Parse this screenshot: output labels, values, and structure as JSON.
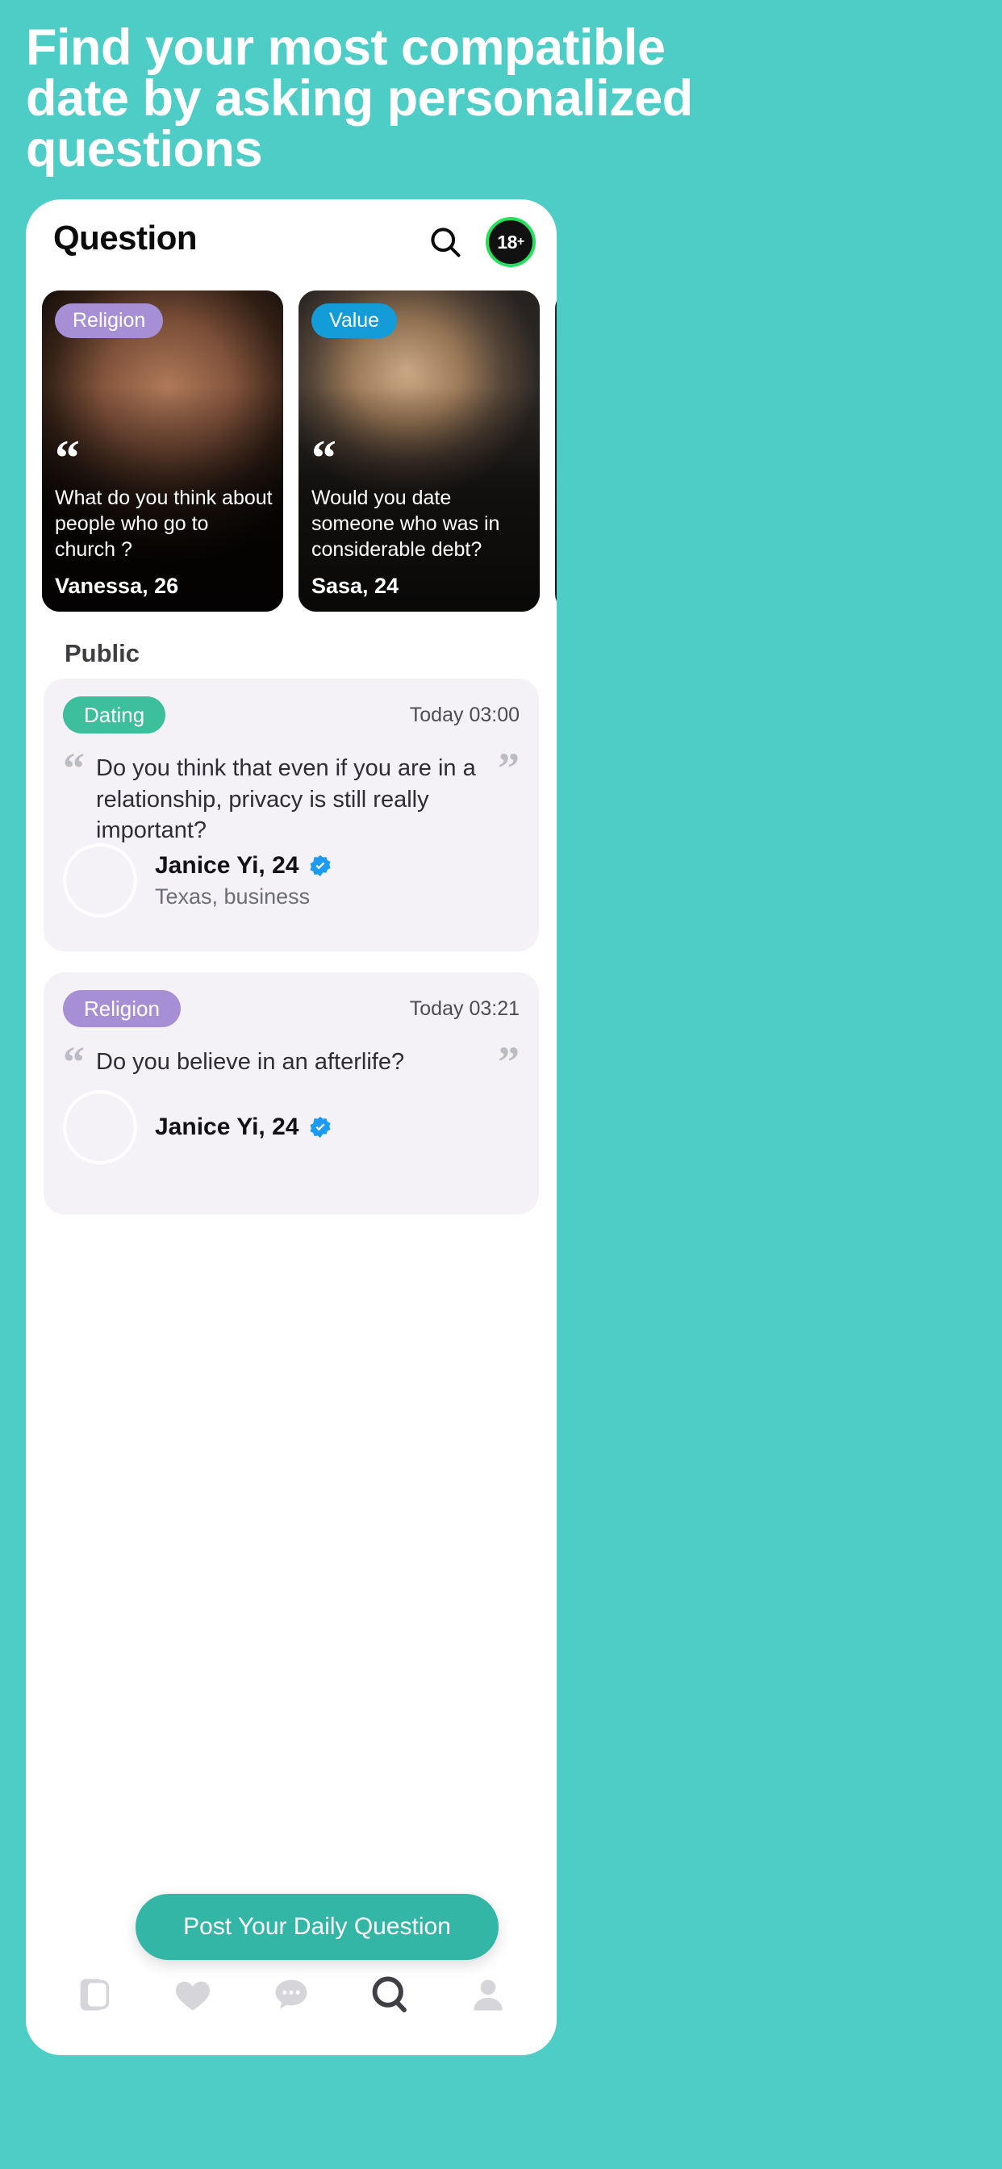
{
  "promo": {
    "headline_lines": [
      "Find your most compatible",
      "date by asking personalized",
      "questions"
    ],
    "background_color": "#4ECDC7"
  },
  "app_header": {
    "title": "Question",
    "search_icon": "search-icon",
    "age_badge": {
      "label": "18",
      "suffix": "+",
      "ring_color": "#25E05A",
      "fill_color": "#111111"
    }
  },
  "carousel": {
    "cards": [
      {
        "tag": "Religion",
        "tag_color": "#a78fd6",
        "quote_mark": "“",
        "question": "What do you think about people who go to church ?",
        "name": "Vanessa, 26"
      },
      {
        "tag": "Value",
        "tag_color": "#139cd8",
        "quote_mark": "“",
        "question": "Would you date someone who was in considerable debt?",
        "name": "Sasa, 24"
      },
      {
        "tag": "",
        "tag_color": "#2a2a2a",
        "quote_mark": "",
        "question": "",
        "name": ""
      }
    ]
  },
  "public_section": {
    "title": "Public",
    "posts": [
      {
        "tag": "Dating",
        "tag_color": "#3dbf9b",
        "time": "Today 03:00",
        "quote_open": "“",
        "quote_close": "”",
        "question": "Do you think that even if you are in a relationship, privacy is still really important?",
        "user_name": "Janice Yi, 24",
        "verified": true,
        "user_meta": "Texas, business"
      },
      {
        "tag": "Religion",
        "tag_color": "#a78fd6",
        "time": "Today 03:21",
        "quote_open": "“",
        "quote_close": "”",
        "question": "Do you believe in an afterlife?",
        "user_name": "Janice Yi, 24",
        "verified": true,
        "user_meta": ""
      }
    ]
  },
  "cta": {
    "label": "Post Your Daily Question",
    "color": "#34b6a6"
  },
  "bottom_nav": {
    "items": [
      {
        "icon": "cards-stack-icon",
        "active": false
      },
      {
        "icon": "heart-icon",
        "active": false
      },
      {
        "icon": "chat-bubble-icon",
        "active": false
      },
      {
        "icon": "question-q-icon",
        "active": true
      },
      {
        "icon": "person-icon",
        "active": false
      }
    ],
    "inactive_color": "#d6d6da",
    "active_color": "#3f3f45"
  }
}
